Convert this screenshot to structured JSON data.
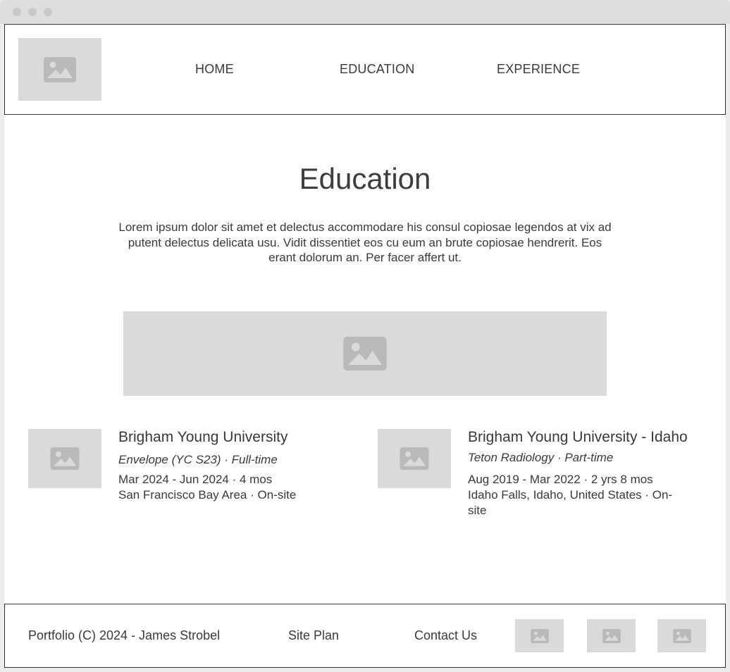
{
  "nav": {
    "logo_icon": "image-placeholder-icon",
    "items": [
      {
        "label": "HOME"
      },
      {
        "label": "EDUCATION"
      },
      {
        "label": "EXPERIENCE"
      }
    ]
  },
  "main": {
    "title": "Education",
    "intro": "Lorem ipsum dolor sit amet et delectus accommodare his consul copiosae legendos at vix ad putent delectus delicata usu. Vidit dissentiet eos cu eum an brute copiosae hendrerit. Eos erant dolorum an. Per facer affert ut.",
    "hero_icon": "image-placeholder-icon",
    "entries": [
      {
        "school": "Brigham Young University",
        "role": "Envelope (YC S23) · Full-time",
        "dates": "Mar 2024 - Jun 2024 · 4 mos",
        "location": "San Francisco Bay Area · On-site"
      },
      {
        "school": "Brigham Young University - Idaho",
        "role": "Teton Radiology · Part-time",
        "dates": "Aug 2019 - Mar 2022 · 2 yrs 8 mos",
        "location": "Idaho Falls, Idaho, United States · On-site"
      }
    ]
  },
  "footer": {
    "copyright": "Portfolio (C) 2024 - James Strobel",
    "site_plan": "Site Plan",
    "contact": "Contact Us",
    "social_icons": [
      "image-placeholder-icon",
      "image-placeholder-icon",
      "image-placeholder-icon"
    ]
  },
  "colors": {
    "placeholder": "#dadada",
    "placeholder_icon": "#b9b9b9",
    "text": "#3a3a3a",
    "border": "#333333"
  }
}
